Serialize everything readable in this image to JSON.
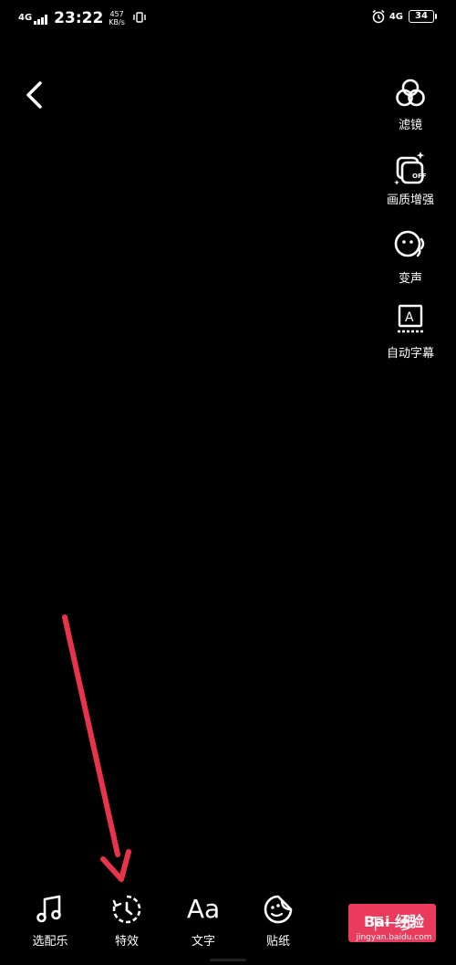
{
  "status_bar": {
    "network_left": "4G",
    "time": "23:22",
    "speed_value": "457",
    "speed_unit": "KB/s",
    "network_right": "4G",
    "battery": "34"
  },
  "side_tools": [
    {
      "label": "滤镜",
      "icon": "filter-icon"
    },
    {
      "label": "画质增强",
      "icon": "quality-enhance-icon",
      "badge": "OFF"
    },
    {
      "label": "变声",
      "icon": "voice-change-icon"
    },
    {
      "label": "自动字幕",
      "icon": "auto-caption-icon",
      "glyph": "A"
    }
  ],
  "bottom_bar": {
    "music_label": "选配乐",
    "effects_label": "特效",
    "text_label": "文字",
    "text_glyph": "Aa",
    "sticker_label": "贴纸",
    "next_label": "下一步"
  },
  "watermark": {
    "logo": "Bai 经验",
    "url": "jingyan.baidu.com"
  },
  "colors": {
    "background": "#000000",
    "accent": "#ea3b5c",
    "annotation_arrow": "#e8334a"
  }
}
